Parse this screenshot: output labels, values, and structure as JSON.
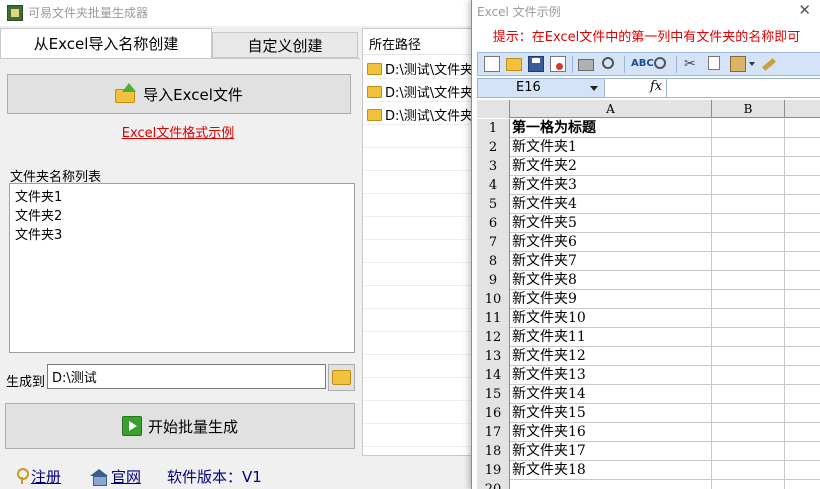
{
  "main_window": {
    "title": "可易文件夹批量生成器",
    "tabs": [
      {
        "label": "从Excel导入名称创建"
      },
      {
        "label": "自定义创建"
      }
    ],
    "import_button_label": "导入Excel文件",
    "format_link": "Excel文件格式示例",
    "list_label": "文件夹名称列表",
    "folder_names": [
      "文件夹1",
      "文件夹2",
      "文件夹3"
    ],
    "generate_to_label": "生成到",
    "generate_to_value": "D:\\测试",
    "start_button_label": "开始批量生成",
    "footer": {
      "register": "注册",
      "website": "官网",
      "version": "软件版本：V1"
    },
    "path_panel": {
      "header": "所在路径",
      "rows": [
        "D:\\测试\\文件夹",
        "D:\\测试\\文件夹",
        "D:\\测试\\文件夹"
      ]
    }
  },
  "excel_window": {
    "title": "Excel 文件示例",
    "close_glyph": "✕",
    "hint": "提示：在Excel文件中的第一列中有文件夹的名称即可",
    "name_box": "E16",
    "fx_label": "fx",
    "columns": [
      "A",
      "B"
    ],
    "rows": [
      {
        "num": "1",
        "a": "第一格为标题"
      },
      {
        "num": "2",
        "a": "新文件夹1"
      },
      {
        "num": "3",
        "a": "新文件夹2"
      },
      {
        "num": "4",
        "a": "新文件夹3"
      },
      {
        "num": "5",
        "a": "新文件夹4"
      },
      {
        "num": "6",
        "a": "新文件夹5"
      },
      {
        "num": "7",
        "a": "新文件夹6"
      },
      {
        "num": "8",
        "a": "新文件夹7"
      },
      {
        "num": "9",
        "a": "新文件夹8"
      },
      {
        "num": "10",
        "a": "新文件夹9"
      },
      {
        "num": "11",
        "a": "新文件夹10"
      },
      {
        "num": "12",
        "a": "新文件夹11"
      },
      {
        "num": "13",
        "a": "新文件夹12"
      },
      {
        "num": "14",
        "a": "新文件夹13"
      },
      {
        "num": "15",
        "a": "新文件夹14"
      },
      {
        "num": "16",
        "a": "新文件夹15"
      },
      {
        "num": "17",
        "a": "新文件夹16"
      },
      {
        "num": "18",
        "a": "新文件夹17"
      },
      {
        "num": "19",
        "a": "新文件夹18"
      },
      {
        "num": "20",
        "a": ""
      }
    ]
  },
  "colors": {
    "accent_red": "#e00000",
    "link_blue": "#000080",
    "toolbar_blue": "#d4e3f7"
  }
}
